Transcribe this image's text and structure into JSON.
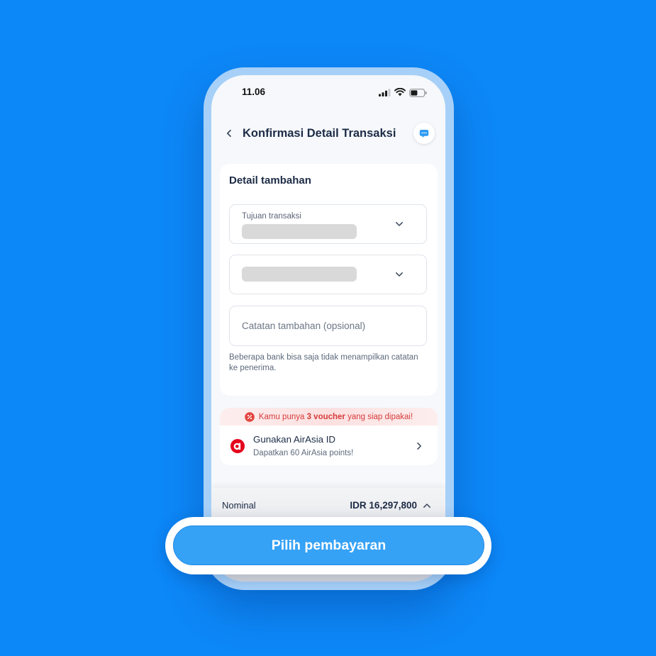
{
  "status_bar": {
    "time": "11.06"
  },
  "header": {
    "title": "Konfirmasi Detail Transaksi"
  },
  "details_card": {
    "title": "Detail tambahan",
    "purpose_field": {
      "label": "Tujuan transaksi"
    },
    "notes_field": {
      "placeholder": "Catatan tambahan (opsional)"
    },
    "helper_text": "Beberapa bank bisa saja tidak menampilkan catatan ke penerima."
  },
  "voucher_banner": {
    "prefix": "Kamu punya ",
    "highlight": "3 voucher",
    "suffix": " yang siap dipakai!"
  },
  "airasia": {
    "title": "Gunakan AirAsia ID",
    "subtitle": "Dapatkan 60 AirAsia points!"
  },
  "summary": {
    "label": "Nominal",
    "amount": "IDR 16,297,800"
  },
  "cta": {
    "label": "Pilih pembayaran"
  },
  "icons": {
    "signal": "cellular-signal-icon",
    "wifi": "wifi-icon",
    "battery": "battery-icon",
    "back": "chevron-left-icon",
    "chat": "chat-bubble-icon",
    "dropdown": "chevron-down-icon",
    "voucher": "voucher-percent-icon",
    "airasia": "airasia-logo-icon",
    "row_arrow": "chevron-right-icon",
    "expand": "chevron-up-icon"
  },
  "colors": {
    "page_background": "#0D88F8",
    "primary_button": "#36A2F6",
    "voucher_text": "#D63B3B",
    "airasia_red": "#E4051C",
    "text_primary": "#1C2B45"
  }
}
